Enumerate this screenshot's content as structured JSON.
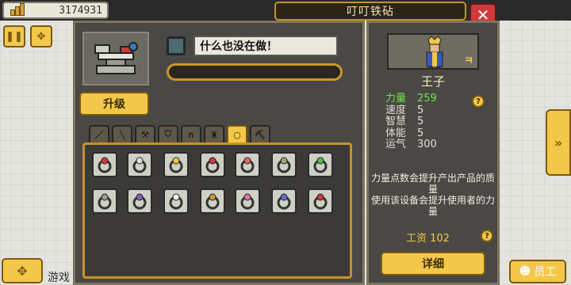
{
  "topbar": {
    "money": "3174931"
  },
  "window": {
    "title": "叮叮铁砧",
    "close_label": "✕"
  },
  "left": {
    "status_text": "什么也没在做！",
    "progress": 0,
    "upgrade_label": "升级",
    "tabs": [
      "sword-icon",
      "staff-icon",
      "axe-icon",
      "shield-icon",
      "helmet-icon",
      "armor-icon",
      "ring-icon",
      "tool-icon"
    ],
    "active_tab": 6,
    "items": [
      "ring-red-icon",
      "ring-moon-icon",
      "star-ring-icon",
      "ruby-ring-icon",
      "pearl-ring-icon",
      "bead-necklace-icon",
      "emerald-ring-icon",
      "pendant-icon",
      "grape-necklace-icon",
      "horn-icon",
      "gold-ring-icon",
      "heart-necklace-icon",
      "amethyst-ring-icon",
      "rose-ring-icon"
    ]
  },
  "right": {
    "character_name": "王子",
    "level_badge": "ㅋ",
    "stats": [
      {
        "label": "力量",
        "value": "259",
        "highlight": true
      },
      {
        "label": "速度",
        "value": "5"
      },
      {
        "label": "智慧",
        "value": "5"
      },
      {
        "label": "体能",
        "value": "5"
      },
      {
        "label": "运气",
        "value": "300"
      }
    ],
    "description": "力量点数会提升产出产品的质量\n使用该设备会提升使用者的力量",
    "wage": "工资 102",
    "detail_label": "详细"
  },
  "bottom": {
    "staff_label": "员工",
    "game_text": "游戏"
  },
  "colors": {
    "accent": "#f3c84a",
    "panel": "#494844",
    "highlight": "#6ee04a"
  }
}
